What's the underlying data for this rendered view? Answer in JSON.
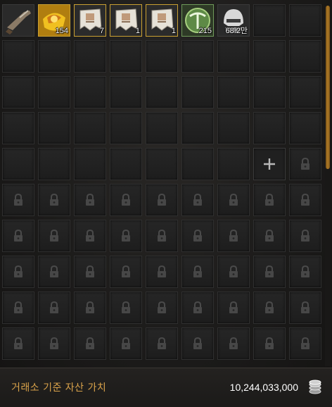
{
  "inventory": {
    "items": [
      {
        "icon": "flintlock-pistol-icon",
        "frame": "plain",
        "qty": ""
      },
      {
        "icon": "gold-emblem-icon",
        "frame": "gold",
        "qty": "154"
      },
      {
        "icon": "scroll-banner-icon",
        "frame": "gold",
        "qty": "7"
      },
      {
        "icon": "scroll-banner-icon",
        "frame": "gold",
        "qty": "1"
      },
      {
        "icon": "scroll-banner-icon",
        "frame": "gold",
        "qty": "1"
      },
      {
        "icon": "pickaxe-icon",
        "frame": "green",
        "qty": "215"
      },
      {
        "icon": "helmet-icon",
        "frame": "plain",
        "qty": "68.2만"
      }
    ],
    "unlocked_slots": 43,
    "add_slot_symbol": "+",
    "total_slots": 90
  },
  "footer": {
    "label": "거래소 기준 자산 가치",
    "value": "10,244,033,000",
    "coin_icon": "silver-coin-stack-icon"
  },
  "colors": {
    "label": "#d9a24a",
    "gold_frame": "#c9a032",
    "green_frame": "#6f9a5a",
    "scroll_thumb": "#b07a26"
  }
}
